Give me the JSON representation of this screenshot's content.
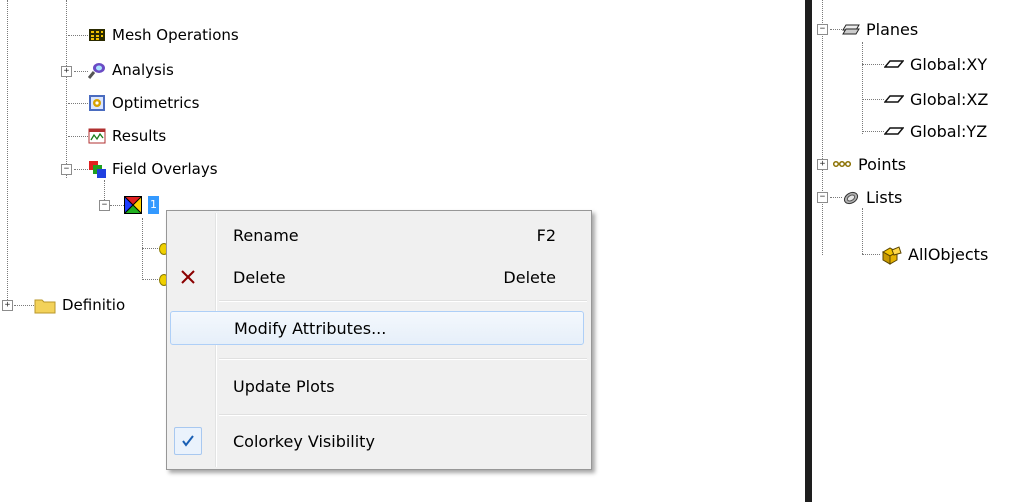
{
  "left_tree": {
    "items": [
      {
        "label": "Mesh Operations",
        "icon": "mesh-operations-icon"
      },
      {
        "label": "Analysis",
        "icon": "analysis-icon"
      },
      {
        "label": "Optimetrics",
        "icon": "optimetrics-icon"
      },
      {
        "label": "Results",
        "icon": "results-icon"
      },
      {
        "label": "Field Overlays",
        "icon": "field-overlays-icon"
      },
      {
        "label": "1",
        "icon": "field-plot-icon"
      },
      {
        "label": "Definitio",
        "icon": "folder-icon"
      }
    ]
  },
  "context_menu": {
    "items": [
      {
        "label": "Rename",
        "shortcut": "F2"
      },
      {
        "label": "Delete",
        "shortcut": "Delete",
        "icon": "delete-x-icon"
      },
      {
        "label": "Modify Attributes...",
        "highlighted": true
      },
      {
        "label": "Update Plots"
      },
      {
        "label": "Colorkey Visibility",
        "checked": true,
        "icon": "checkmark-icon"
      }
    ]
  },
  "right_tree": {
    "items": [
      {
        "label": "Planes",
        "icon": "planes-icon"
      },
      {
        "label": "Global:XY",
        "icon": "plane-icon"
      },
      {
        "label": "Global:XZ",
        "icon": "plane-icon"
      },
      {
        "label": "Global:YZ",
        "icon": "plane-icon"
      },
      {
        "label": "Points",
        "icon": "points-icon"
      },
      {
        "label": "Lists",
        "icon": "lists-icon"
      },
      {
        "label": "AllObjects",
        "icon": "allobjects-icon"
      }
    ]
  },
  "colors": {
    "menu_bg": "#f0f0f0",
    "highlight_border": "#aecff7",
    "delete_x": "#8b0000",
    "check": "#1a5fb4"
  }
}
